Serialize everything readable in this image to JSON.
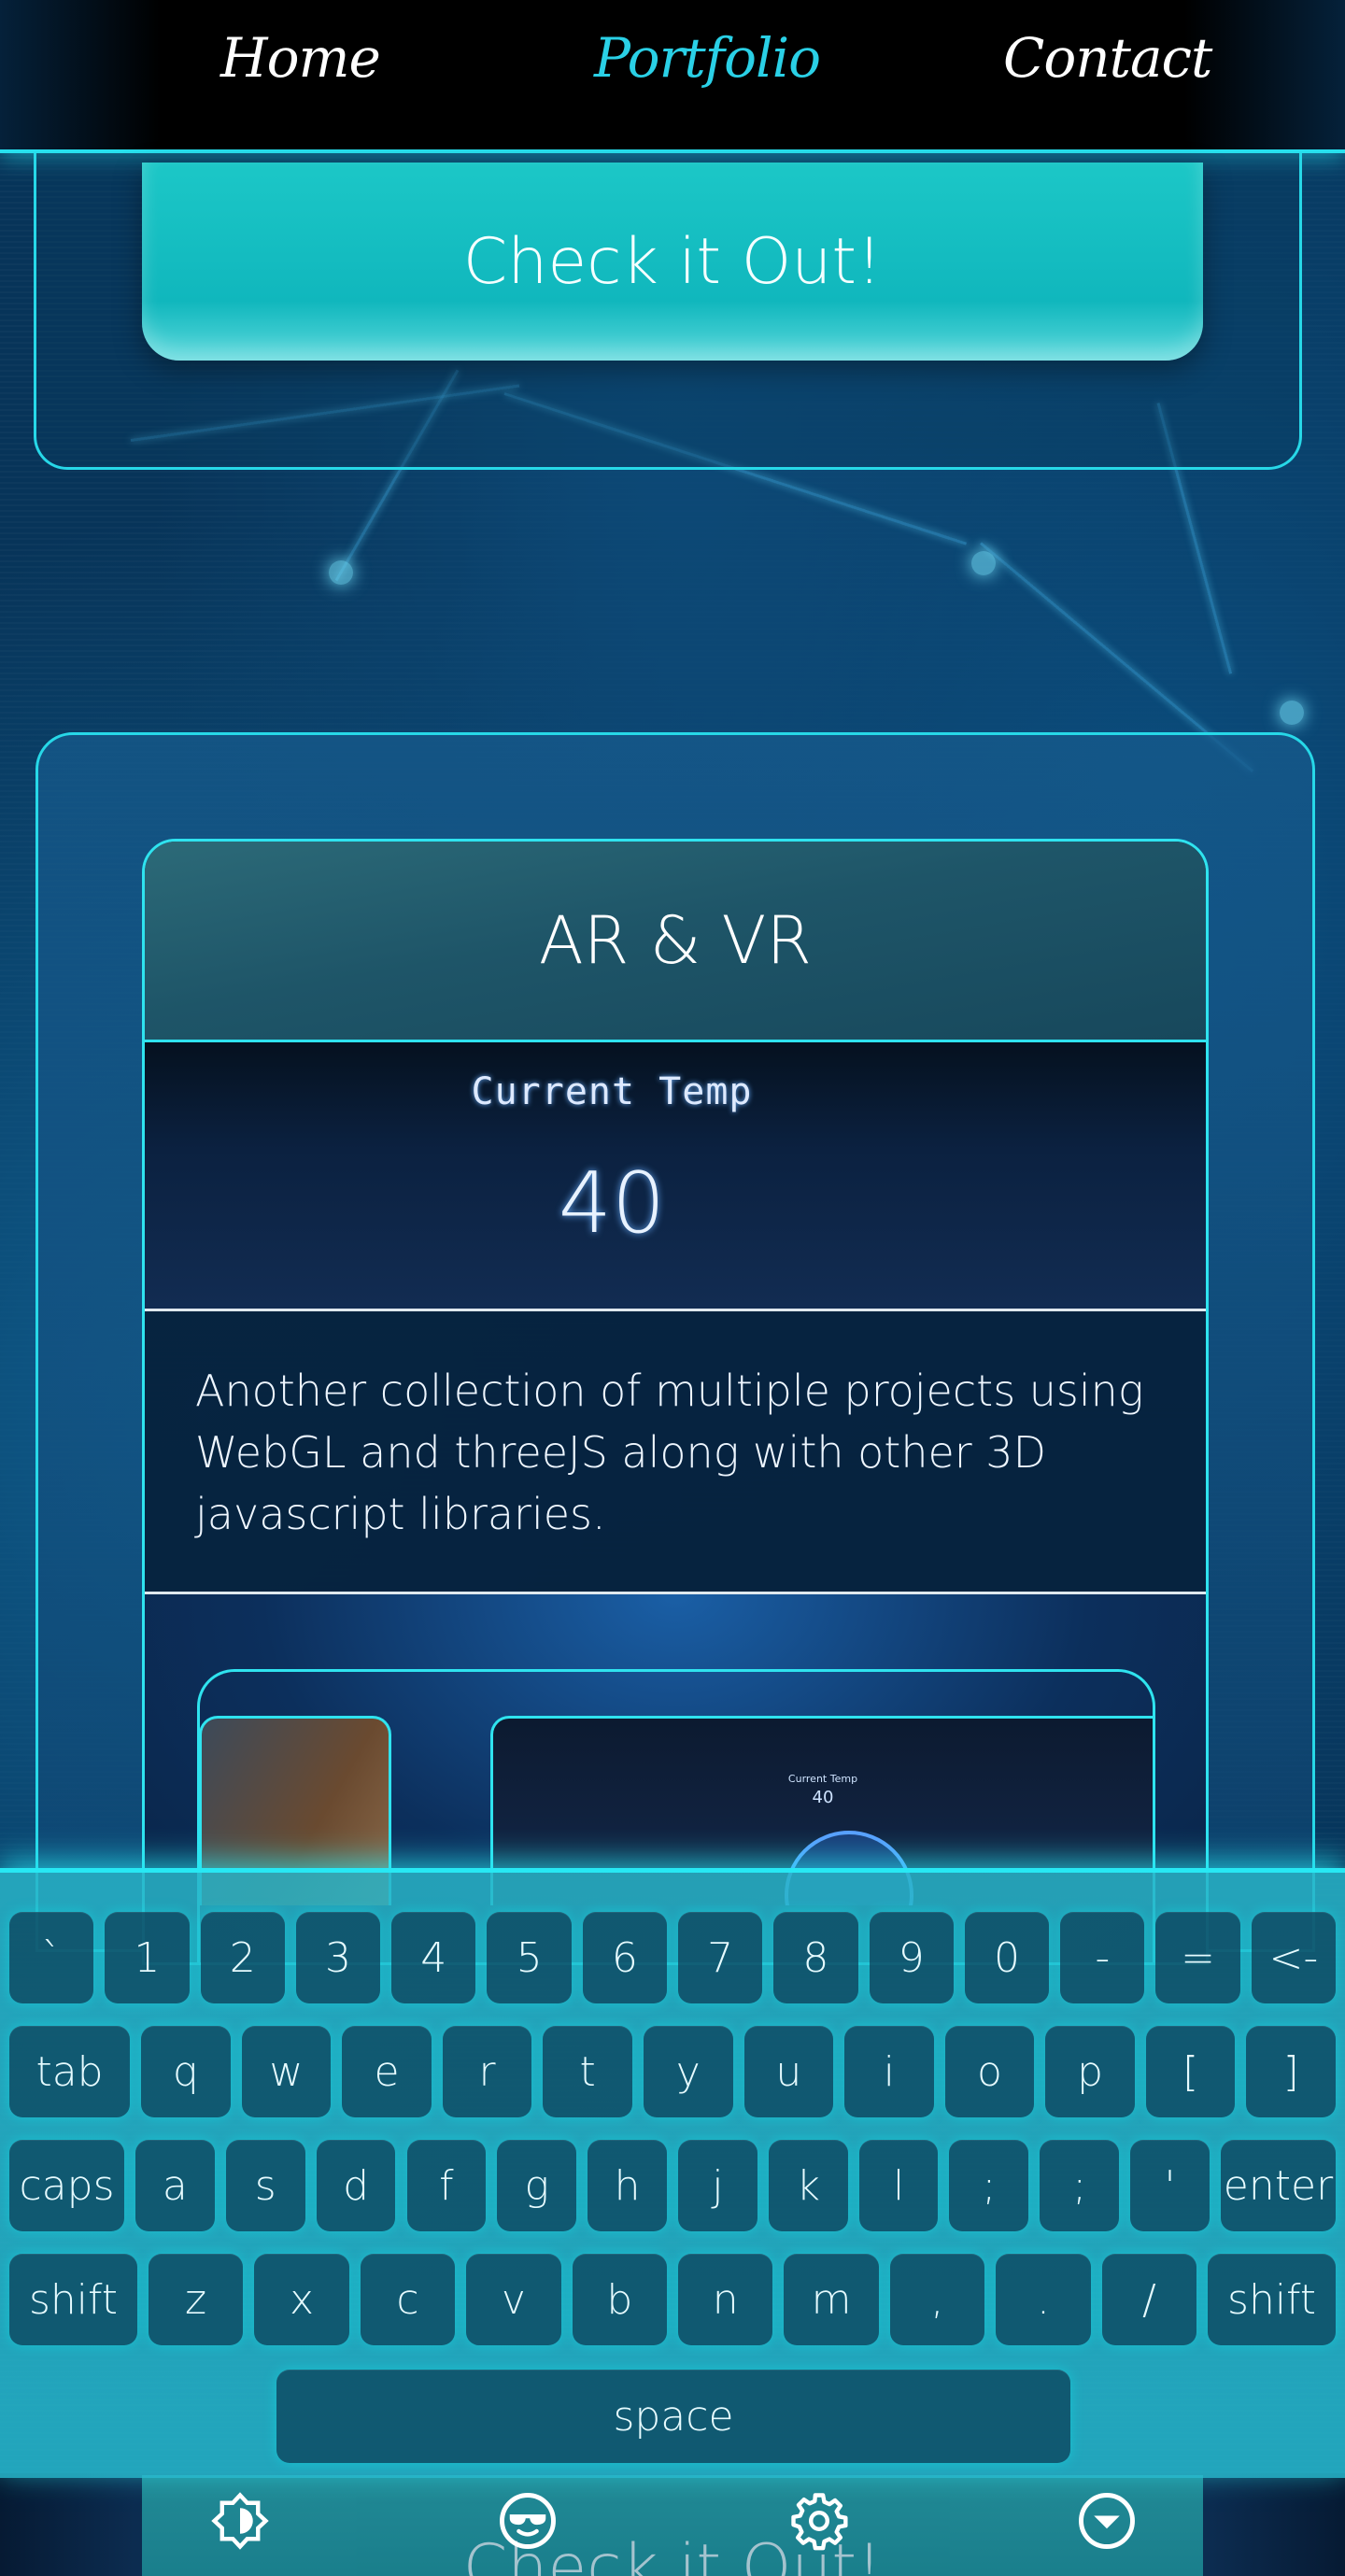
{
  "nav": {
    "items": [
      {
        "label": "Home"
      },
      {
        "label": "Portfolio"
      },
      {
        "label": "Contact"
      }
    ]
  },
  "top_card": {
    "button_label": "Check it Out!"
  },
  "portfolio": {
    "title": "AR & VR",
    "preview": {
      "label": "Current Temp",
      "value": "40"
    },
    "description": "Another collection of multiple projects using WebGL and threeJS along with other 3D javascript libraries.",
    "thumb": {
      "label": "Current Temp",
      "value": "40"
    }
  },
  "keyboard": {
    "rows": [
      [
        "`",
        "1",
        "2",
        "3",
        "4",
        "5",
        "6",
        "7",
        "8",
        "9",
        "0",
        "-",
        "=",
        "<-"
      ],
      [
        "tab",
        "q",
        "w",
        "e",
        "r",
        "t",
        "y",
        "u",
        "i",
        "o",
        "p",
        "[",
        "]"
      ],
      [
        "caps",
        "a",
        "s",
        "d",
        "f",
        "g",
        "h",
        "j",
        "k",
        "l",
        ";",
        ";",
        "'",
        "enter"
      ],
      [
        "shift",
        "z",
        "x",
        "c",
        "v",
        "b",
        "n",
        "m",
        ",",
        ".",
        "/",
        "shift"
      ]
    ],
    "space_label": "space"
  },
  "bottom": {
    "ghost_button_label": "Check it Out!",
    "icons": [
      "brightness-icon",
      "sunglasses-emoji-icon",
      "gear-icon",
      "chevron-down-circle-icon"
    ]
  },
  "colors": {
    "accent": "#27e0ee",
    "button": "#10b7bd",
    "nav_active": "#2ad0e6",
    "nav_bg": "#000000"
  }
}
